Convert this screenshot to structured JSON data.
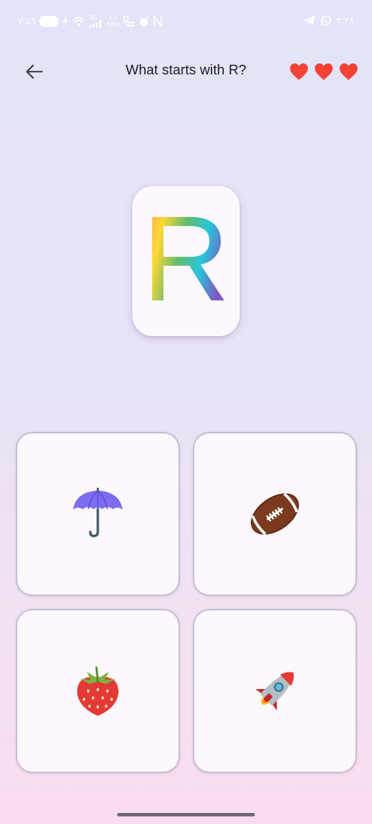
{
  "status_bar": {
    "left_text": "۷:۵٦",
    "network_label": "4G",
    "speed_value": "1.1",
    "speed_unit": "KB/s",
    "time": "۲:۲۸"
  },
  "header": {
    "title": "What starts with R?",
    "back_icon": "arrow-left-icon",
    "lives": 3,
    "heart_color": "#f44336"
  },
  "letter_card": {
    "letter": "R",
    "gradient": [
      "#ff8a65",
      "#fdd835",
      "#66bb6a",
      "#26c6da",
      "#7e57c2"
    ]
  },
  "options": [
    {
      "item": "umbrella",
      "icon": "umbrella-icon"
    },
    {
      "item": "football",
      "icon": "football-icon"
    },
    {
      "item": "strawberry",
      "icon": "strawberry-icon"
    },
    {
      "item": "rocket",
      "icon": "rocket-icon"
    }
  ],
  "colors": {
    "card_border": "#c6bdd4",
    "card_background": "#fcf8fd",
    "title_text": "#1d1b22"
  }
}
